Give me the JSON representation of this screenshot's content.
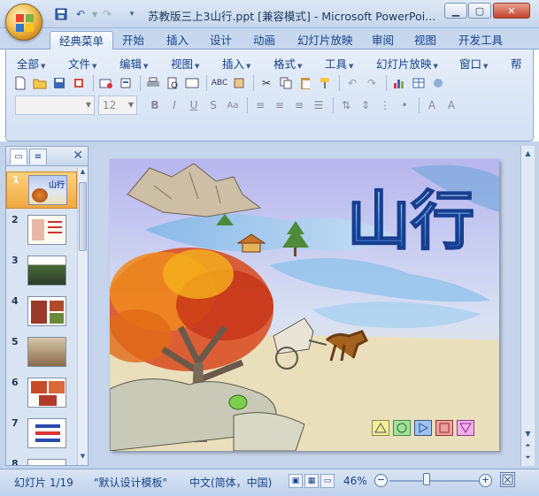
{
  "window": {
    "title": "苏教版三上3山行.ppt [兼容模式] - Microsoft PowerPoi...",
    "minimize_icon": "minimize-icon",
    "maximize_icon": "maximize-icon",
    "close_icon": "close-icon"
  },
  "quick_access": [
    "save-icon",
    "undo-icon",
    "redo-icon",
    "customize-icon"
  ],
  "ribbon_tabs": [
    "经典菜单",
    "开始",
    "插入",
    "设计",
    "动画",
    "幻灯片放映",
    "审阅",
    "视图",
    "开发工具"
  ],
  "active_tab": "经典菜单",
  "classic_menu": [
    "全部",
    "文件",
    "编辑",
    "视图",
    "插入",
    "格式",
    "工具",
    "幻灯片放映",
    "窗口",
    "帮"
  ],
  "font_box": {
    "name": "",
    "size": "12"
  },
  "panel": {
    "tabs": [
      "slides-tab",
      "outline-tab"
    ],
    "slides": [
      {
        "num": "1",
        "label": "山行"
      },
      {
        "num": "2",
        "label": ""
      },
      {
        "num": "3",
        "label": ""
      },
      {
        "num": "4",
        "label": ""
      },
      {
        "num": "5",
        "label": ""
      },
      {
        "num": "6",
        "label": ""
      },
      {
        "num": "7",
        "label": ""
      },
      {
        "num": "8",
        "label": ""
      }
    ],
    "selected": "1"
  },
  "slide": {
    "title": "山行",
    "nav_buttons": [
      "triangle-button",
      "circle-button",
      "play-button",
      "square-button",
      "down-triangle-button"
    ]
  },
  "status": {
    "slide_info": "幻灯片 1/19",
    "template": "\"默认设计模板\"",
    "language": "中文(简体，中国)",
    "zoom": "46%",
    "zoom_level": 0.46
  },
  "colors": {
    "ribbon_bg": "#d3e1f3",
    "accent_selected": "#f1a941",
    "title_text": "#1e395b"
  }
}
